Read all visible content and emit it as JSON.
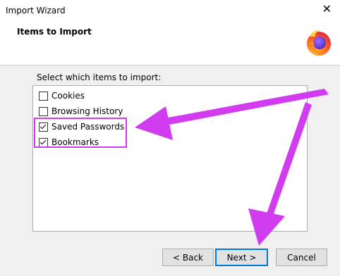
{
  "window": {
    "title": "Import Wizard",
    "close_glyph": "✕"
  },
  "header": {
    "heading": "Items to Import",
    "logo_icon": "firefox-logo"
  },
  "main": {
    "prompt": "Select which items to import:",
    "items": [
      {
        "label": "Cookies",
        "checked": false
      },
      {
        "label": "Browsing History",
        "checked": false
      },
      {
        "label": "Saved Passwords",
        "checked": true
      },
      {
        "label": "Bookmarks",
        "checked": true
      }
    ]
  },
  "buttons": {
    "back": "< Back",
    "next": "Next >",
    "cancel": "Cancel"
  },
  "colors": {
    "annotation": "#d23cf0",
    "focus_border": "#0078d7"
  }
}
